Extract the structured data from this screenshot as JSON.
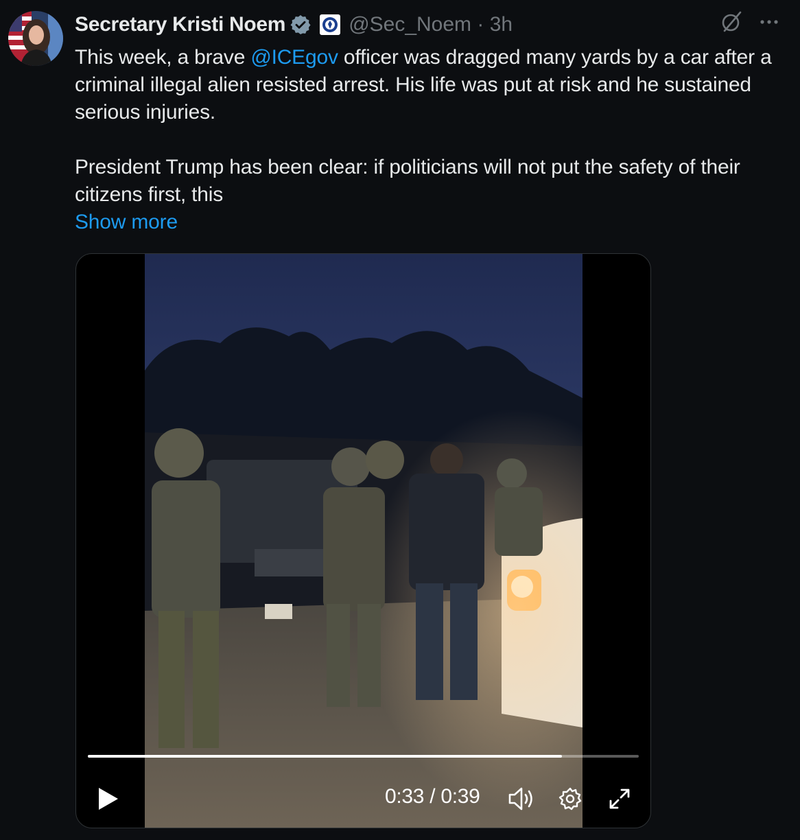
{
  "author": {
    "display_name": "Secretary Kristi Noem",
    "handle": "@Sec_Noem",
    "separator": "·",
    "time_ago": "3h",
    "verified_color": "#829aab"
  },
  "post": {
    "para1_before": "This week, a brave ",
    "mention": "@ICEgov",
    "para1_after": " officer was dragged many yards by a car after a criminal illegal alien resisted arrest. His life was put at risk and he sustained serious injuries.",
    "para2": "President Trump has been clear: if politicians will not put the safety of their citizens first, this",
    "show_more": "Show more"
  },
  "video": {
    "current_time": "0:33",
    "time_separator": " / ",
    "duration": "0:39",
    "progress": 0.86
  },
  "icons": {
    "grok": "grok-icon",
    "more": "more-icon",
    "play": "play-icon",
    "volume": "volume-icon",
    "settings": "gear-icon",
    "fullscreen": "expand-icon"
  },
  "colors": {
    "background": "#0c0e11",
    "text": "#e7e9ea",
    "secondary": "#71767b",
    "link": "#1d9bf0"
  }
}
